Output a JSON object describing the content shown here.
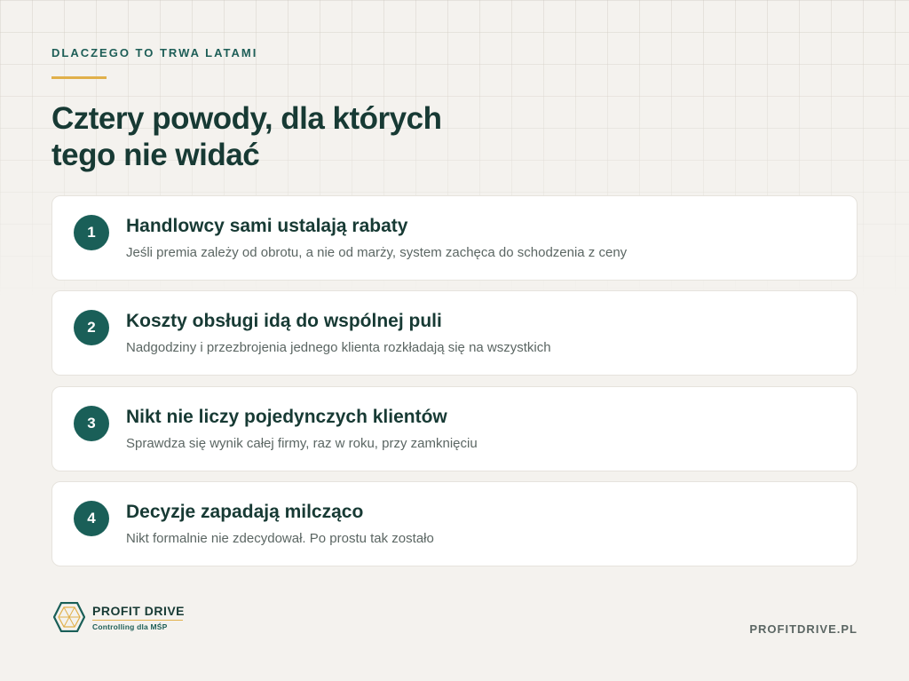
{
  "header": {
    "eyebrow": "DLACZEGO TO TRWA LATAMI",
    "title_line1": "Cztery powody, dla których",
    "title_line2": "tego nie widać"
  },
  "reasons": [
    {
      "number": "1",
      "title": "Handlowcy sami ustalają rabaty",
      "description": "Jeśli premia zależy od obrotu, a nie od marży, system zachęca do schodzenia z ceny"
    },
    {
      "number": "2",
      "title": "Koszty obsługi idą do wspólnej puli",
      "description": "Nadgodziny i przezbrojenia jednego klienta rozkładają się na wszystkich"
    },
    {
      "number": "3",
      "title": "Nikt nie liczy pojedynczych klientów",
      "description": "Sprawdza się wynik całej firmy, raz w roku, przy zamknięciu"
    },
    {
      "number": "4",
      "title": "Decyzje zapadają milcząco",
      "description": "Nikt formalnie nie zdecydował. Po prostu tak zostało"
    }
  ],
  "footer": {
    "brand_name": "PROFIT DRIVE",
    "brand_tagline": "Controlling dla MŚP",
    "url": "PROFITDRIVE.PL"
  },
  "colors": {
    "background": "#f4f2ee",
    "primary": "#1a5f58",
    "accent": "#e1b04a",
    "heading": "#173a34"
  }
}
